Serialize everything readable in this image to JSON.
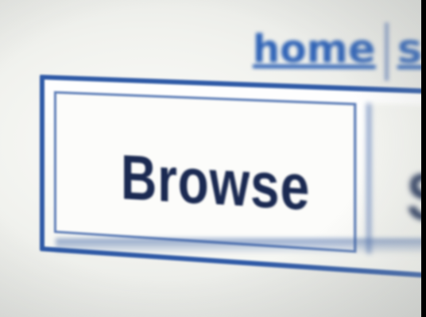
{
  "top_nav": {
    "home_label": "home",
    "next_label": "se"
  },
  "tabs": {
    "browse_label": "Browse",
    "search_label": "Se"
  },
  "colors": {
    "link_blue": "#2f63b6",
    "tab_border": "#2f5aa6",
    "text_dark": "#1b2a52"
  }
}
